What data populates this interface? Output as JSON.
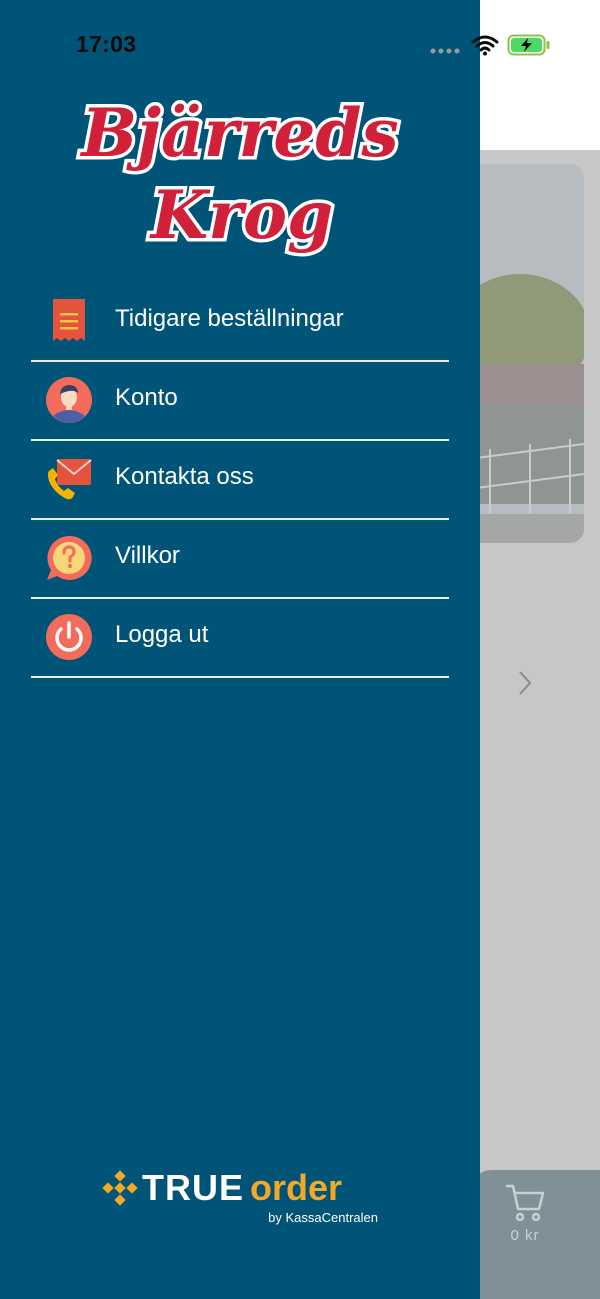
{
  "status_bar": {
    "time": "17:03"
  },
  "brand": {
    "name_line1": "Bjärreds",
    "name_line2": "Krog"
  },
  "menu": {
    "items": [
      {
        "label": "Tidigare beställningar",
        "icon": "receipt-icon"
      },
      {
        "label": "Konto",
        "icon": "account-avatar-icon"
      },
      {
        "label": "Kontakta oss",
        "icon": "contact-phone-mail-icon"
      },
      {
        "label": "Villkor",
        "icon": "terms-question-icon"
      },
      {
        "label": "Logga ut",
        "icon": "power-icon"
      }
    ]
  },
  "footer": {
    "logo_part1": "TRUE",
    "logo_part2": "order",
    "byline": "by KassaCentralen"
  },
  "background": {
    "cart_total": "0 kr"
  },
  "colors": {
    "drawer_bg": "#005478",
    "brand_red": "#d0203a",
    "accent_orange": "#f4a825",
    "icon_coral": "#f26b5b"
  }
}
